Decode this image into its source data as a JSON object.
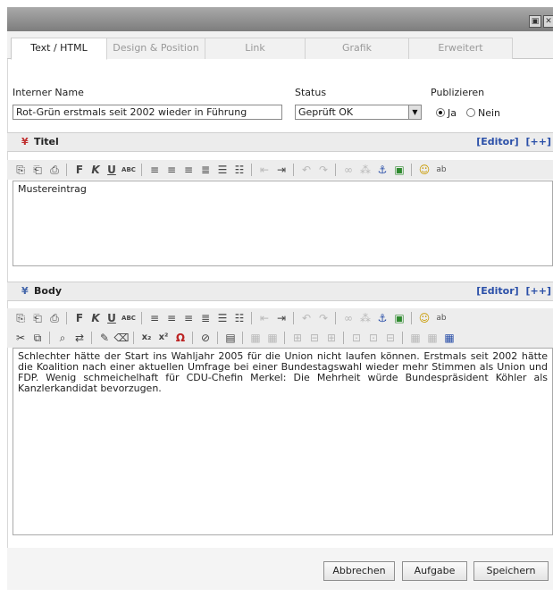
{
  "window": {
    "min_glyph": "▣",
    "close_glyph": "✕"
  },
  "tabs": [
    {
      "label": "Text / HTML",
      "active": true
    },
    {
      "label": "Design & Position",
      "active": false
    },
    {
      "label": "Link",
      "active": false
    },
    {
      "label": "Grafik",
      "active": false
    },
    {
      "label": "Erweitert",
      "active": false
    }
  ],
  "form": {
    "internal_name_label": "Interner Name",
    "internal_name_value": "Rot-Grün erstmals seit 2002 wieder in Führung",
    "status_label": "Status",
    "status_value": "Geprüft OK",
    "publish_label": "Publizieren",
    "publish_yes": "Ja",
    "publish_no": "Nein",
    "publish_selected": "Ja"
  },
  "title_section": {
    "title": "Titel",
    "editor_link": "[Editor]",
    "more_link": "[++]",
    "content": "Mustereintrag"
  },
  "body_section": {
    "title": "Body",
    "editor_link": "[Editor]",
    "more_link": "[++]",
    "content": "Schlechter hätte der Start ins Wahljahr 2005 für die Union nicht laufen können. Erstmals seit 2002 hätte die Koalition nach einer aktuellen Umfrage bei einer Bundestagswahl wieder mehr Stimmen als Union und FDP. Wenig schmeichelhaft für CDU-Chefin Merkel: Die Mehrheit würde Bundespräsident Köhler als Kanzlerkandidat bevorzugen."
  },
  "buttons": {
    "cancel": "Abbrechen",
    "task": "Aufgabe",
    "save": "Speichern"
  },
  "toolbar_glyphs": {
    "paste": "📋",
    "paste_text": "📄",
    "paste_word": "📝",
    "bold": "F",
    "italic": "K",
    "underline": "U",
    "strike": "ABC",
    "align_left": "☰",
    "align_center": "☰",
    "align_right": "☰",
    "justify": "☰",
    "bullets": "☷",
    "numbers": "☷",
    "outdent": "⇤",
    "indent": "⇥",
    "undo": "↶",
    "redo": "↷",
    "link": "∞",
    "unlink": "⁂",
    "anchor": "⚓",
    "image": "▣",
    "smiley": "☺",
    "spell": "ab",
    "cut": "✂",
    "copy": "⧉",
    "find": "⌕",
    "replace": "⇄",
    "format_paint": "✎",
    "erase": "⌫",
    "subscript": "x₂",
    "superscript": "x²",
    "omega": "Ω",
    "flash": "⊘",
    "form": "▤",
    "table_a": "▦",
    "table_b": "▦",
    "table_c": "▦",
    "table_d": "▦",
    "table_e": "▦",
    "table_f": "▦",
    "table_g": "▦",
    "table_h": "▦",
    "table_i": "▦"
  }
}
